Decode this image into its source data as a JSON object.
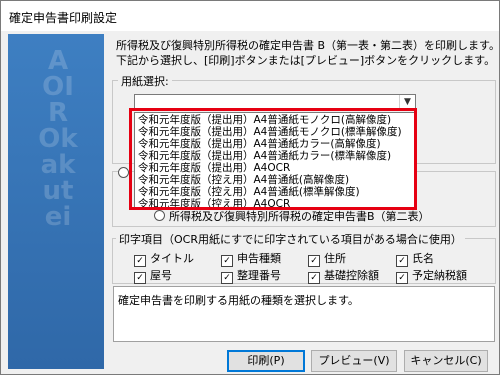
{
  "window": {
    "title": "確定申告書印刷設定"
  },
  "side_panel": {
    "watermark": "AOIROkakutei"
  },
  "intro": {
    "line1": "所得税及び復興特別所得税の確定申告書 B（第一表・第二表）を印刷します。",
    "line2": "下記から選択し、[印刷]ボタンまたは[プレビュー]ボタンをクリックします。"
  },
  "paper_select": {
    "label": "用紙選択:",
    "value": "",
    "options": [
      "令和元年度版（提出用）A4普通紙モノクロ(高解像度)",
      "令和元年度版（提出用）A4普通紙モノクロ(標準解像度)",
      "令和元年度版（提出用）A4普通紙カラー(高解像度)",
      "令和元年度版（提出用）A4普通紙カラー(標準解像度)",
      "令和元年度版（提出用）A4OCR",
      "令和元年度版（控え用）A4普通紙(高解像度)",
      "令和元年度版（控え用）A4普通紙(標準解像度)",
      "令和元年度版（控え用）A4OCR"
    ]
  },
  "radio_option": {
    "label": "所得税及び復興特別所得税の確定申告書B（第二表）"
  },
  "print_items": {
    "label": "印字項目（OCR用紙にすでに印字されている項目がある場合に使用）",
    "checkboxes": [
      {
        "label": "タイトル",
        "checked": true
      },
      {
        "label": "申告種類",
        "checked": true
      },
      {
        "label": "住所",
        "checked": true
      },
      {
        "label": "氏名",
        "checked": true
      },
      {
        "label": "屋号",
        "checked": true
      },
      {
        "label": "整理番号",
        "checked": true
      },
      {
        "label": "基礎控除額",
        "checked": true
      },
      {
        "label": "予定納税額",
        "checked": true
      }
    ]
  },
  "description": "確定申告書を印刷する用紙の種類を選択します。",
  "buttons": {
    "print": "印刷(P)",
    "preview": "プレビュー(V)",
    "cancel": "キャンセル(C)"
  },
  "colors": {
    "side_panel": "#3e7fc2",
    "highlight": "#e60012",
    "default_button_border": "#0078d7"
  },
  "icons": {
    "checkbox_mark": "✓",
    "dropdown_arrow": "▼"
  }
}
